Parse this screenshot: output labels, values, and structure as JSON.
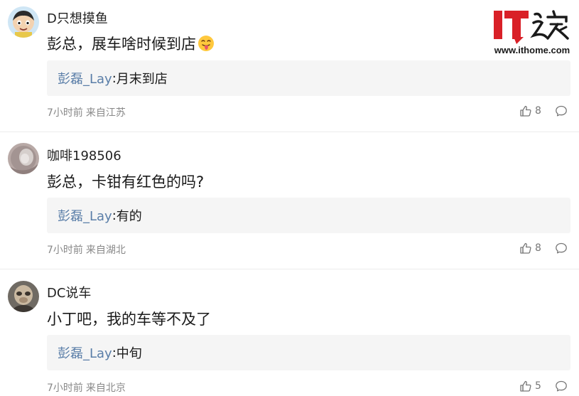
{
  "logo": {
    "text": "IT之家",
    "url": "www.ithome.com",
    "brand_color": "#d92027"
  },
  "comments": [
    {
      "username": "D只想摸鱼",
      "content": "彭总，展车啥时候到店",
      "content_emoji": "tongue-out-emoji",
      "reply": {
        "author": "彭磊_Lay",
        "separator": ":",
        "text": "月末到店"
      },
      "time": "7小时前",
      "location": "来自江苏",
      "likes": "8",
      "avatar": "cartoon-avatar"
    },
    {
      "username": "咖啡198506",
      "content": "彭总，卡钳有红色的吗?",
      "reply": {
        "author": "彭磊_Lay",
        "separator": ":",
        "text": "有的"
      },
      "time": "7小时前",
      "location": "来自湖北",
      "likes": "8",
      "avatar": "photo-avatar"
    },
    {
      "username": "DC说车",
      "content": "小丁吧，我的车等不及了",
      "reply": {
        "author": "彭磊_Lay",
        "separator": ":",
        "text": "中旬"
      },
      "time": "7小时前",
      "location": "来自北京",
      "likes": "5",
      "avatar": "photo-avatar"
    }
  ],
  "colors": {
    "reply_author": "#5a7ea8",
    "meta_text": "#888888",
    "reply_background": "#f5f5f5"
  }
}
